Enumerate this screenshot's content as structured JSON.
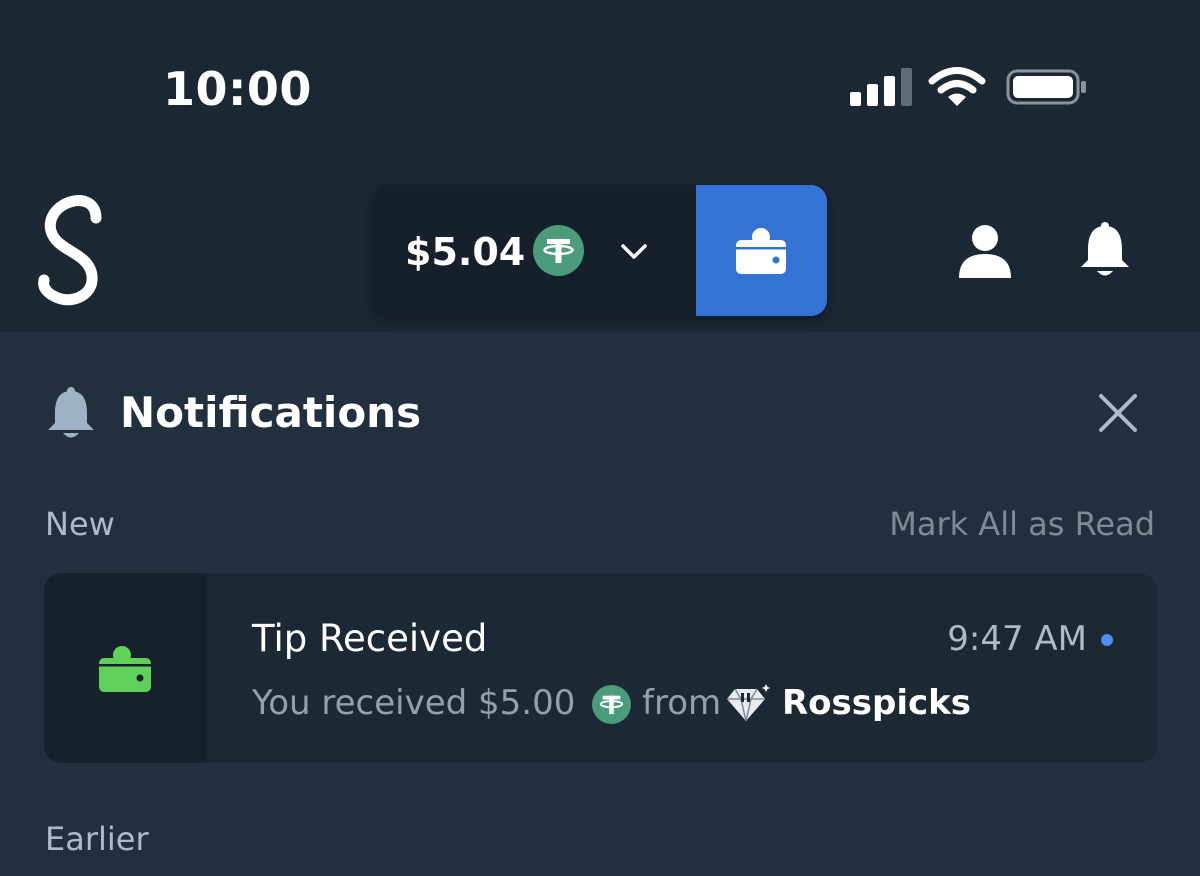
{
  "status_bar": {
    "time": "10:00",
    "signal_icon": "signal-icon",
    "wifi_icon": "wifi-icon",
    "battery_icon": "battery-icon"
  },
  "header": {
    "logo_icon": "stake-logo-icon",
    "balance": "$5.04",
    "currency_icon": "tether-icon",
    "dropdown_icon": "chevron-down-icon",
    "wallet_icon": "wallet-icon",
    "profile_icon": "user-icon",
    "notifications_icon": "bell-icon"
  },
  "notifications": {
    "title": "Notifications",
    "close_icon": "close-icon",
    "section_new": "New",
    "mark_all_read": "Mark All as Read",
    "items": [
      {
        "icon": "wallet-icon",
        "title": "Tip Received",
        "time": "9:47 AM",
        "unread": true,
        "message_prefix": "You received $5.00",
        "currency_icon": "tether-icon",
        "message_from": "from",
        "user_badge_icon": "diamond-vip-icon",
        "username": "Rosspicks"
      }
    ],
    "section_earlier": "Earlier"
  },
  "colors": {
    "header_bg": "#1b2733",
    "panel_bg": "#22303d",
    "card_bg": "#1c2834",
    "accent_blue": "#3473d6",
    "tether_green": "#4a9c7a",
    "wallet_green": "#5fd15a",
    "unread_dot": "#4f8ff2"
  }
}
